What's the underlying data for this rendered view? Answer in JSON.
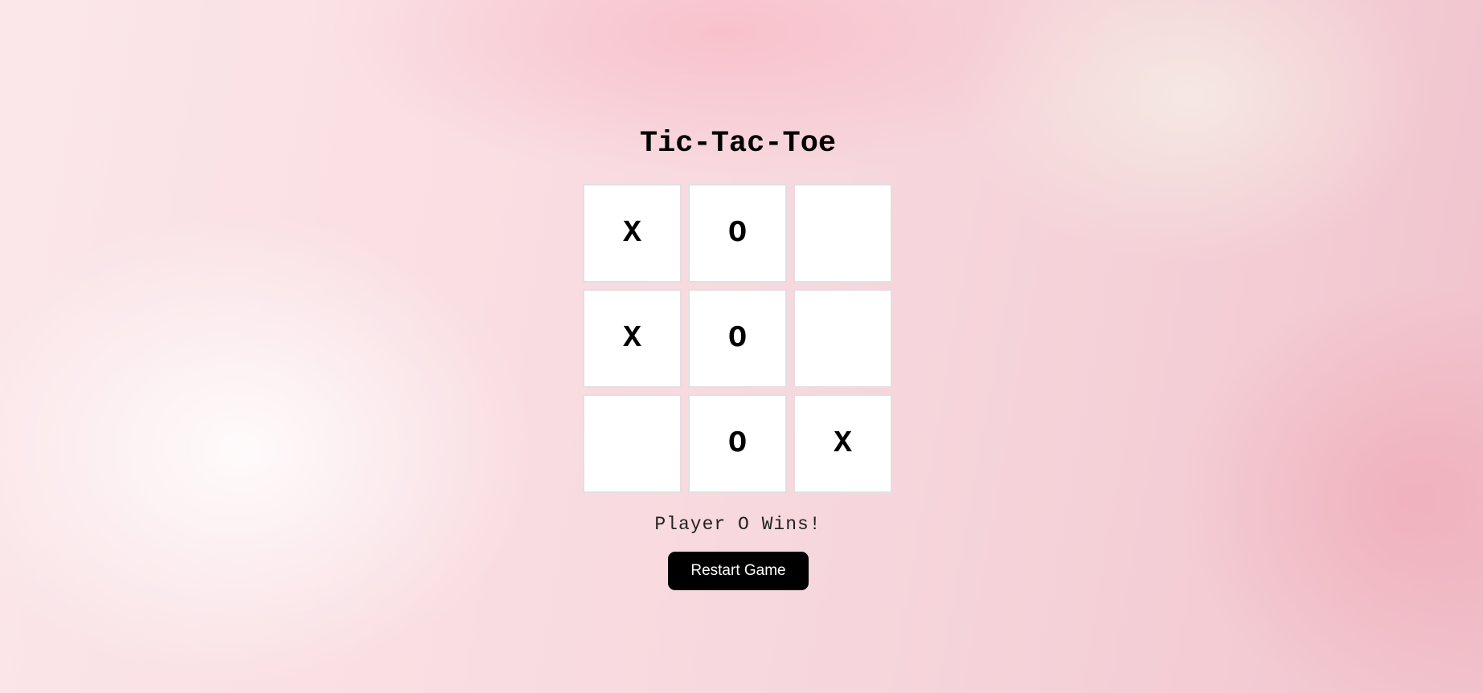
{
  "game": {
    "title": "Tic-Tac-Toe",
    "board": [
      [
        "X",
        "O",
        ""
      ],
      [
        "X",
        "O",
        ""
      ],
      [
        "",
        "O",
        "X"
      ]
    ],
    "status": "Player O Wins!",
    "restart_label": "Restart Game"
  },
  "colors": {
    "cell_background": "#ffffff",
    "button_background": "#000000",
    "button_text": "#ffffff",
    "background_tint": "#f6d6dc"
  }
}
